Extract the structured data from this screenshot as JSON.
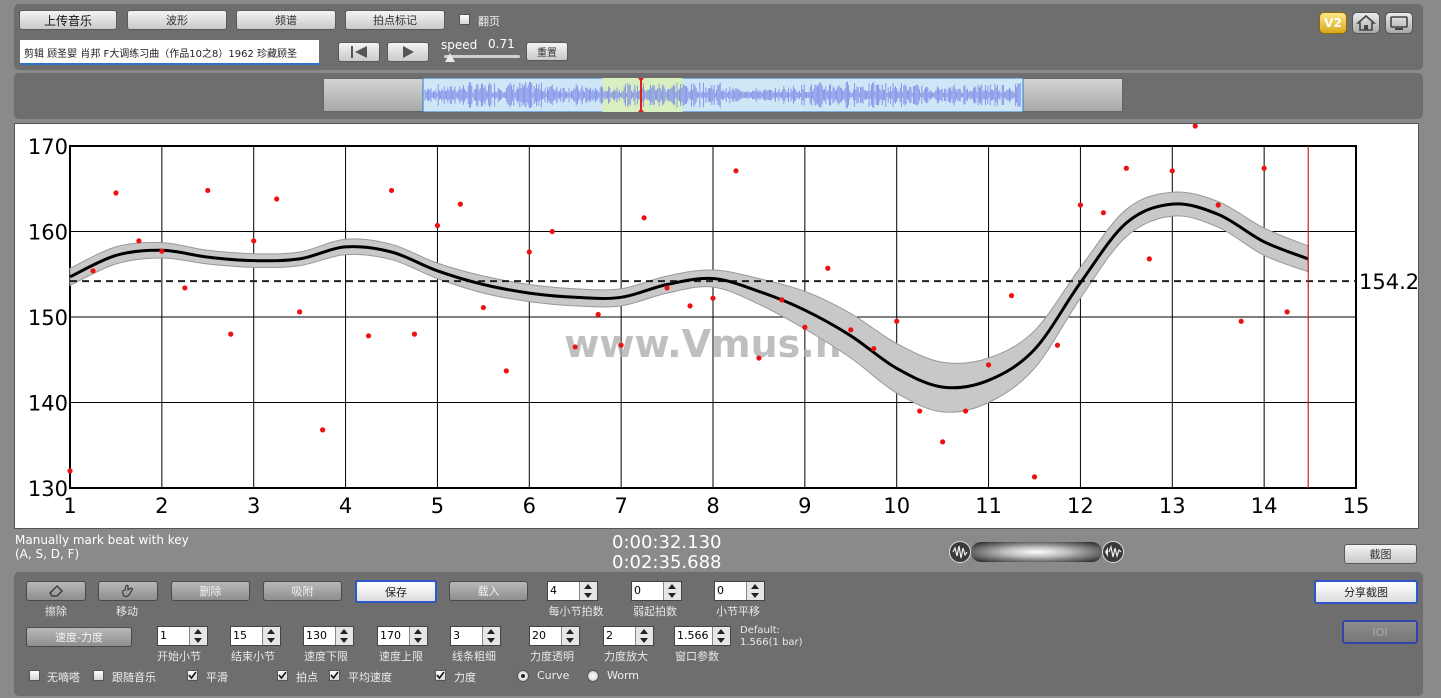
{
  "toolbar": {
    "upload_label": "上传音乐",
    "waveform_label": "波形",
    "spectrum_label": "频谱",
    "beat_mark_label": "拍点标记",
    "page_turn_label": "翻页",
    "track_title": "剪辑 顾圣婴 肖邦 F大调练习曲（作品10之8）1962 珍藏顾圣",
    "speed_label": "speed",
    "speed_value": "0.71",
    "speed_fraction": 0.08,
    "reset_label": "重置",
    "v2_label": "V2"
  },
  "chart_data": {
    "type": "line",
    "title": "",
    "xlabel": "",
    "ylabel": "",
    "xlim": [
      1,
      15
    ],
    "ylim": [
      130,
      170
    ],
    "x_ticks": [
      1,
      2,
      3,
      4,
      5,
      6,
      7,
      8,
      9,
      10,
      11,
      12,
      13,
      14,
      15
    ],
    "y_ticks": [
      130,
      140,
      150,
      160,
      170
    ],
    "grid": true,
    "average_line": 154.2,
    "average_label": "154.2",
    "cursor_x": 14.48,
    "smooth_curve": {
      "x": [
        1,
        1.5,
        2,
        2.5,
        3,
        3.5,
        4,
        4.5,
        5,
        5.5,
        6,
        6.5,
        7,
        7.5,
        8,
        8.5,
        9,
        9.5,
        10,
        10.5,
        11,
        11.5,
        12,
        12.5,
        13,
        13.5,
        14,
        14.48
      ],
      "y": [
        154.7,
        157.2,
        157.8,
        157.0,
        156.6,
        156.8,
        158.2,
        157.6,
        155.4,
        153.8,
        152.8,
        152.3,
        152.3,
        153.8,
        154.5,
        153.0,
        150.8,
        147.8,
        144.0,
        141.8,
        142.6,
        146.2,
        154.0,
        161.0,
        163.2,
        162.0,
        158.8,
        156.8
      ]
    },
    "band_halfwidth": [
      1.0,
      1.0,
      0.9,
      0.8,
      0.8,
      0.8,
      0.9,
      0.9,
      0.9,
      1.0,
      1.0,
      1.0,
      1.0,
      1.0,
      1.0,
      1.5,
      2.2,
      2.6,
      2.9,
      2.9,
      2.6,
      2.2,
      1.8,
      1.6,
      1.4,
      1.5,
      1.6,
      1.5
    ],
    "points": [
      [
        1,
        132
      ],
      [
        1.25,
        155.4
      ],
      [
        1.5,
        164.5
      ],
      [
        1.75,
        158.9
      ],
      [
        2,
        157.7
      ],
      [
        2.25,
        153.4
      ],
      [
        2.5,
        164.8
      ],
      [
        2.75,
        148
      ],
      [
        3,
        158.9
      ],
      [
        3.25,
        163.8
      ],
      [
        3.5,
        150.6
      ],
      [
        3.75,
        136.8
      ],
      [
        4.25,
        147.8
      ],
      [
        4.5,
        164.8
      ],
      [
        4.75,
        148
      ],
      [
        5,
        160.7
      ],
      [
        5.25,
        163.2
      ],
      [
        5.5,
        151.1
      ],
      [
        5.75,
        143.7
      ],
      [
        6,
        157.6
      ],
      [
        6.25,
        160
      ],
      [
        6.5,
        146.5
      ],
      [
        6.75,
        150.3
      ],
      [
        7,
        146.7
      ],
      [
        7.25,
        161.6
      ],
      [
        7.5,
        153.4
      ],
      [
        7.75,
        151.3
      ],
      [
        8,
        152.2
      ],
      [
        8.25,
        167.1
      ],
      [
        8.5,
        145.2
      ],
      [
        8.75,
        152
      ],
      [
        9,
        148.8
      ],
      [
        9.25,
        155.7
      ],
      [
        9.5,
        148.5
      ],
      [
        9.75,
        146.3
      ],
      [
        10,
        149.5
      ],
      [
        10.25,
        139
      ],
      [
        10.5,
        135.4
      ],
      [
        10.75,
        139
      ],
      [
        11,
        144.4
      ],
      [
        11.25,
        152.5
      ],
      [
        11.5,
        131.3
      ],
      [
        11.75,
        146.7
      ],
      [
        12,
        163.1
      ],
      [
        12.25,
        162.2
      ],
      [
        12.5,
        167.4
      ],
      [
        12.75,
        156.8
      ],
      [
        13,
        167.1
      ],
      [
        13.25,
        172.5
      ],
      [
        13.5,
        163.1
      ],
      [
        13.75,
        149.5
      ],
      [
        14,
        167.4
      ],
      [
        14.25,
        150.6
      ]
    ]
  },
  "watermark": "www.Vmus.net",
  "overview": {
    "selection_start": 0.3,
    "selection_end": 0.575,
    "playhead": 0.46
  },
  "status": {
    "hint_line1": "Manually mark beat with key",
    "hint_line2": "(A, S, D, F)",
    "time_current": "0:00:32.130",
    "time_total": "0:02:35.688",
    "screenshot_label": "截图"
  },
  "controls": {
    "erase_label": "擦除",
    "move_label": "移动",
    "delete_label": "删除",
    "snap_label": "吸附",
    "save_label": "保存",
    "load_label": "载入",
    "beats_per_bar": {
      "value": "4",
      "label": "每小节拍数"
    },
    "weak_beats": {
      "value": "0",
      "label": "弱起拍数"
    },
    "bar_shift": {
      "value": "0",
      "label": "小节平移"
    },
    "share_label": "分享截图",
    "ioi_label": "IOI",
    "mode_label": "速度-力度",
    "start_bar": {
      "value": "1",
      "label": "开始小节"
    },
    "end_bar": {
      "value": "15",
      "label": "结束小节"
    },
    "tempo_min": {
      "value": "130",
      "label": "速度下限"
    },
    "tempo_max": {
      "value": "170",
      "label": "速度上限"
    },
    "line_width": {
      "value": "3",
      "label": "线条粗细"
    },
    "dyn_transparency": {
      "value": "20",
      "label": "力度透明"
    },
    "dyn_zoom": {
      "value": "2",
      "label": "力度放大"
    },
    "window_param": {
      "value": "1.566",
      "label": "窗口参数"
    },
    "default_line1": "Default:",
    "default_line2": "1.566(1 bar)",
    "metronome_label": "无嘀嗒",
    "follow_label": "跟随音乐",
    "smooth_label": "平滑",
    "beat_point_label": "拍点",
    "avg_tempo_label": "平均速度",
    "dynamics_label": "力度",
    "curve_label": "Curve",
    "worm_label": "Worm"
  }
}
